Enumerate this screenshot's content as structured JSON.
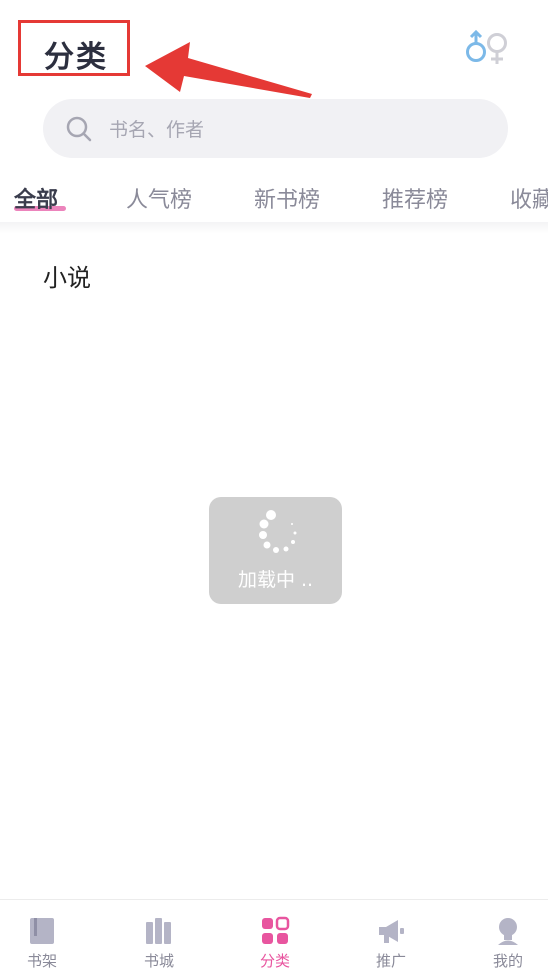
{
  "header": {
    "title": "分类",
    "gender_icon": "gender-icon"
  },
  "search": {
    "placeholder": "书名、作者"
  },
  "tabs": [
    {
      "label": "全部",
      "active": true
    },
    {
      "label": "人气榜"
    },
    {
      "label": "新书榜"
    },
    {
      "label": "推荐榜"
    },
    {
      "label": "收藏"
    }
  ],
  "section": {
    "title": "小说"
  },
  "loading": {
    "text": "加载中 .."
  },
  "bottom_nav": [
    {
      "label": "书架",
      "icon": "bookshelf-icon"
    },
    {
      "label": "书城",
      "icon": "books-icon"
    },
    {
      "label": "分类",
      "icon": "category-icon",
      "active": true
    },
    {
      "label": "推广",
      "icon": "megaphone-icon"
    },
    {
      "label": "我的",
      "icon": "profile-icon"
    }
  ],
  "colors": {
    "accent": "#e8559f",
    "annotation": "#e53935",
    "tab_underline": "#e96fb0"
  }
}
